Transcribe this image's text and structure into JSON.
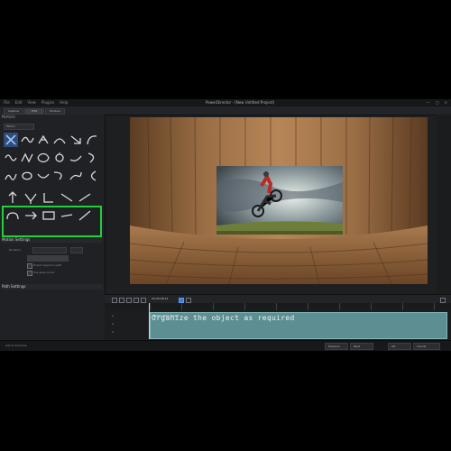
{
  "app": {
    "title": "PowerDirector - [New Untitled Project]",
    "menu": [
      "File",
      "Edit",
      "View",
      "Plugins",
      "Help"
    ],
    "window_buttons": [
      "—",
      "□",
      "✕"
    ]
  },
  "toolbar": {
    "tabs": [
      "Capture",
      "Edit",
      "Produce"
    ]
  },
  "left_panel": {
    "header": "Particle",
    "dropdown": "Motion",
    "section_motion": "Motion Settings",
    "prop_duration_label": "Duration",
    "prop_checkbox_1": "Orient object to path",
    "prop_checkbox_2": "Use ease in/out",
    "section_path": "Path Settings"
  },
  "timeline": {
    "timecode": "00;00;08;13",
    "tracks": [
      "1.",
      "1.",
      "1."
    ],
    "clip_label": "Motion Path Preset",
    "caption": "Organize the object as required"
  },
  "statusbar": {
    "left": "Add to Timeline",
    "buttons": [
      "Previous",
      "Next",
      "OK",
      "Cancel"
    ]
  },
  "colors": {
    "highlight": "#22d13a",
    "clip": "#5d8f92",
    "selection": "#2f4d78"
  },
  "icons": [
    "motion-path-icon"
  ]
}
